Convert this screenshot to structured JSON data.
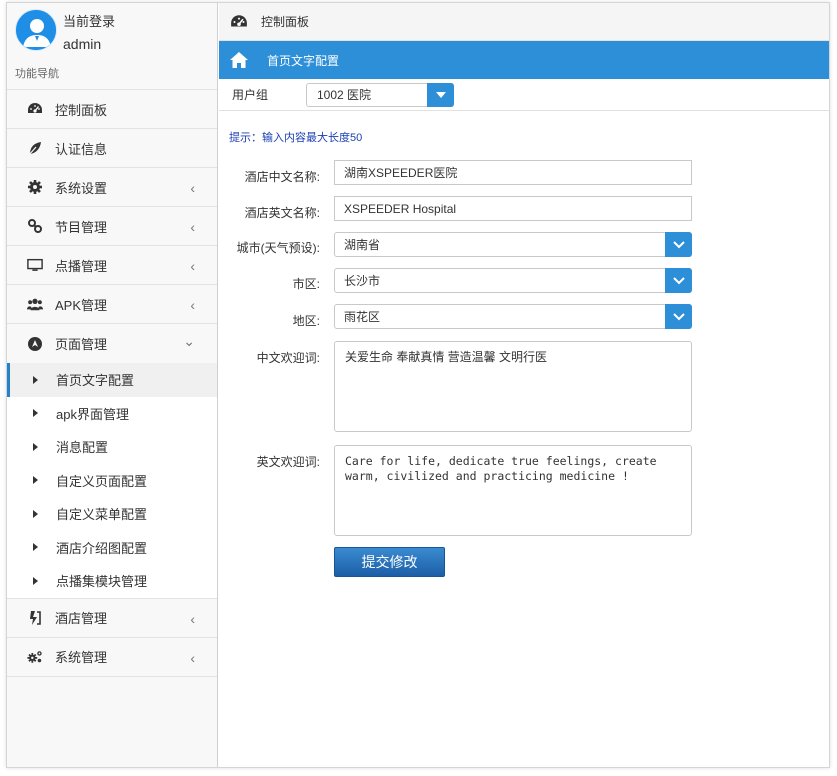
{
  "user": {
    "login_label": "当前登录",
    "name": "admin",
    "nav_caption": "功能导航"
  },
  "sidebar": {
    "items": [
      {
        "label": "控制面板",
        "icon": "dashboard-icon"
      },
      {
        "label": "认证信息",
        "icon": "leaf-icon"
      },
      {
        "label": "系统设置",
        "icon": "gear-icon",
        "arrow": "‹"
      },
      {
        "label": "节目管理",
        "icon": "link-icon",
        "arrow": "‹"
      },
      {
        "label": "点播管理",
        "icon": "monitor-icon",
        "arrow": "‹"
      },
      {
        "label": "APK管理",
        "icon": "users-icon",
        "arrow": "‹"
      },
      {
        "label": "页面管理",
        "icon": "compass-icon",
        "arrow": "⌄"
      }
    ],
    "sub_items": [
      {
        "label": "首页文字配置"
      },
      {
        "label": "apk界面管理"
      },
      {
        "label": "消息配置"
      },
      {
        "label": "自定义页面配置"
      },
      {
        "label": "自定义菜单配置"
      },
      {
        "label": "酒店介绍图配置"
      },
      {
        "label": "点播集模块管理"
      }
    ],
    "bottom_items": [
      {
        "label": "酒店管理",
        "icon": "hotel-icon",
        "arrow": "‹"
      },
      {
        "label": "系统管理",
        "icon": "gears-icon",
        "arrow": "‹"
      }
    ]
  },
  "breadcrumb": {
    "label": "控制面板"
  },
  "panel": {
    "title": "首页文字配置",
    "user_group_label": "用户组",
    "user_group_value": "1002 医院",
    "hint": "提示：输入内容最大长度50"
  },
  "form": {
    "hotel_cn_label": "酒店中文名称:",
    "hotel_cn_value": "湖南XSPEEDER医院",
    "hotel_en_label": "酒店英文名称:",
    "hotel_en_value": "XSPEEDER Hospital",
    "city_weather_label": "城市(天气预设):",
    "city_weather_value": "湖南省",
    "city_label": "市区:",
    "city_value": "长沙市",
    "district_label": "地区:",
    "district_value": "雨花区",
    "welcome_cn_label": "中文欢迎词:",
    "welcome_cn_value": "关爱生命 奉献真情 营造温馨 文明行医",
    "welcome_en_label": "英文欢迎词:",
    "welcome_en_value": "Care for life, dedicate true feelings, create warm, civilized and practicing medicine !",
    "submit_label": "提交修改"
  },
  "colors": {
    "accent": "#2d8fd8",
    "button_dark": "#1c5ea6",
    "hint_text": "#1a3fb3"
  }
}
